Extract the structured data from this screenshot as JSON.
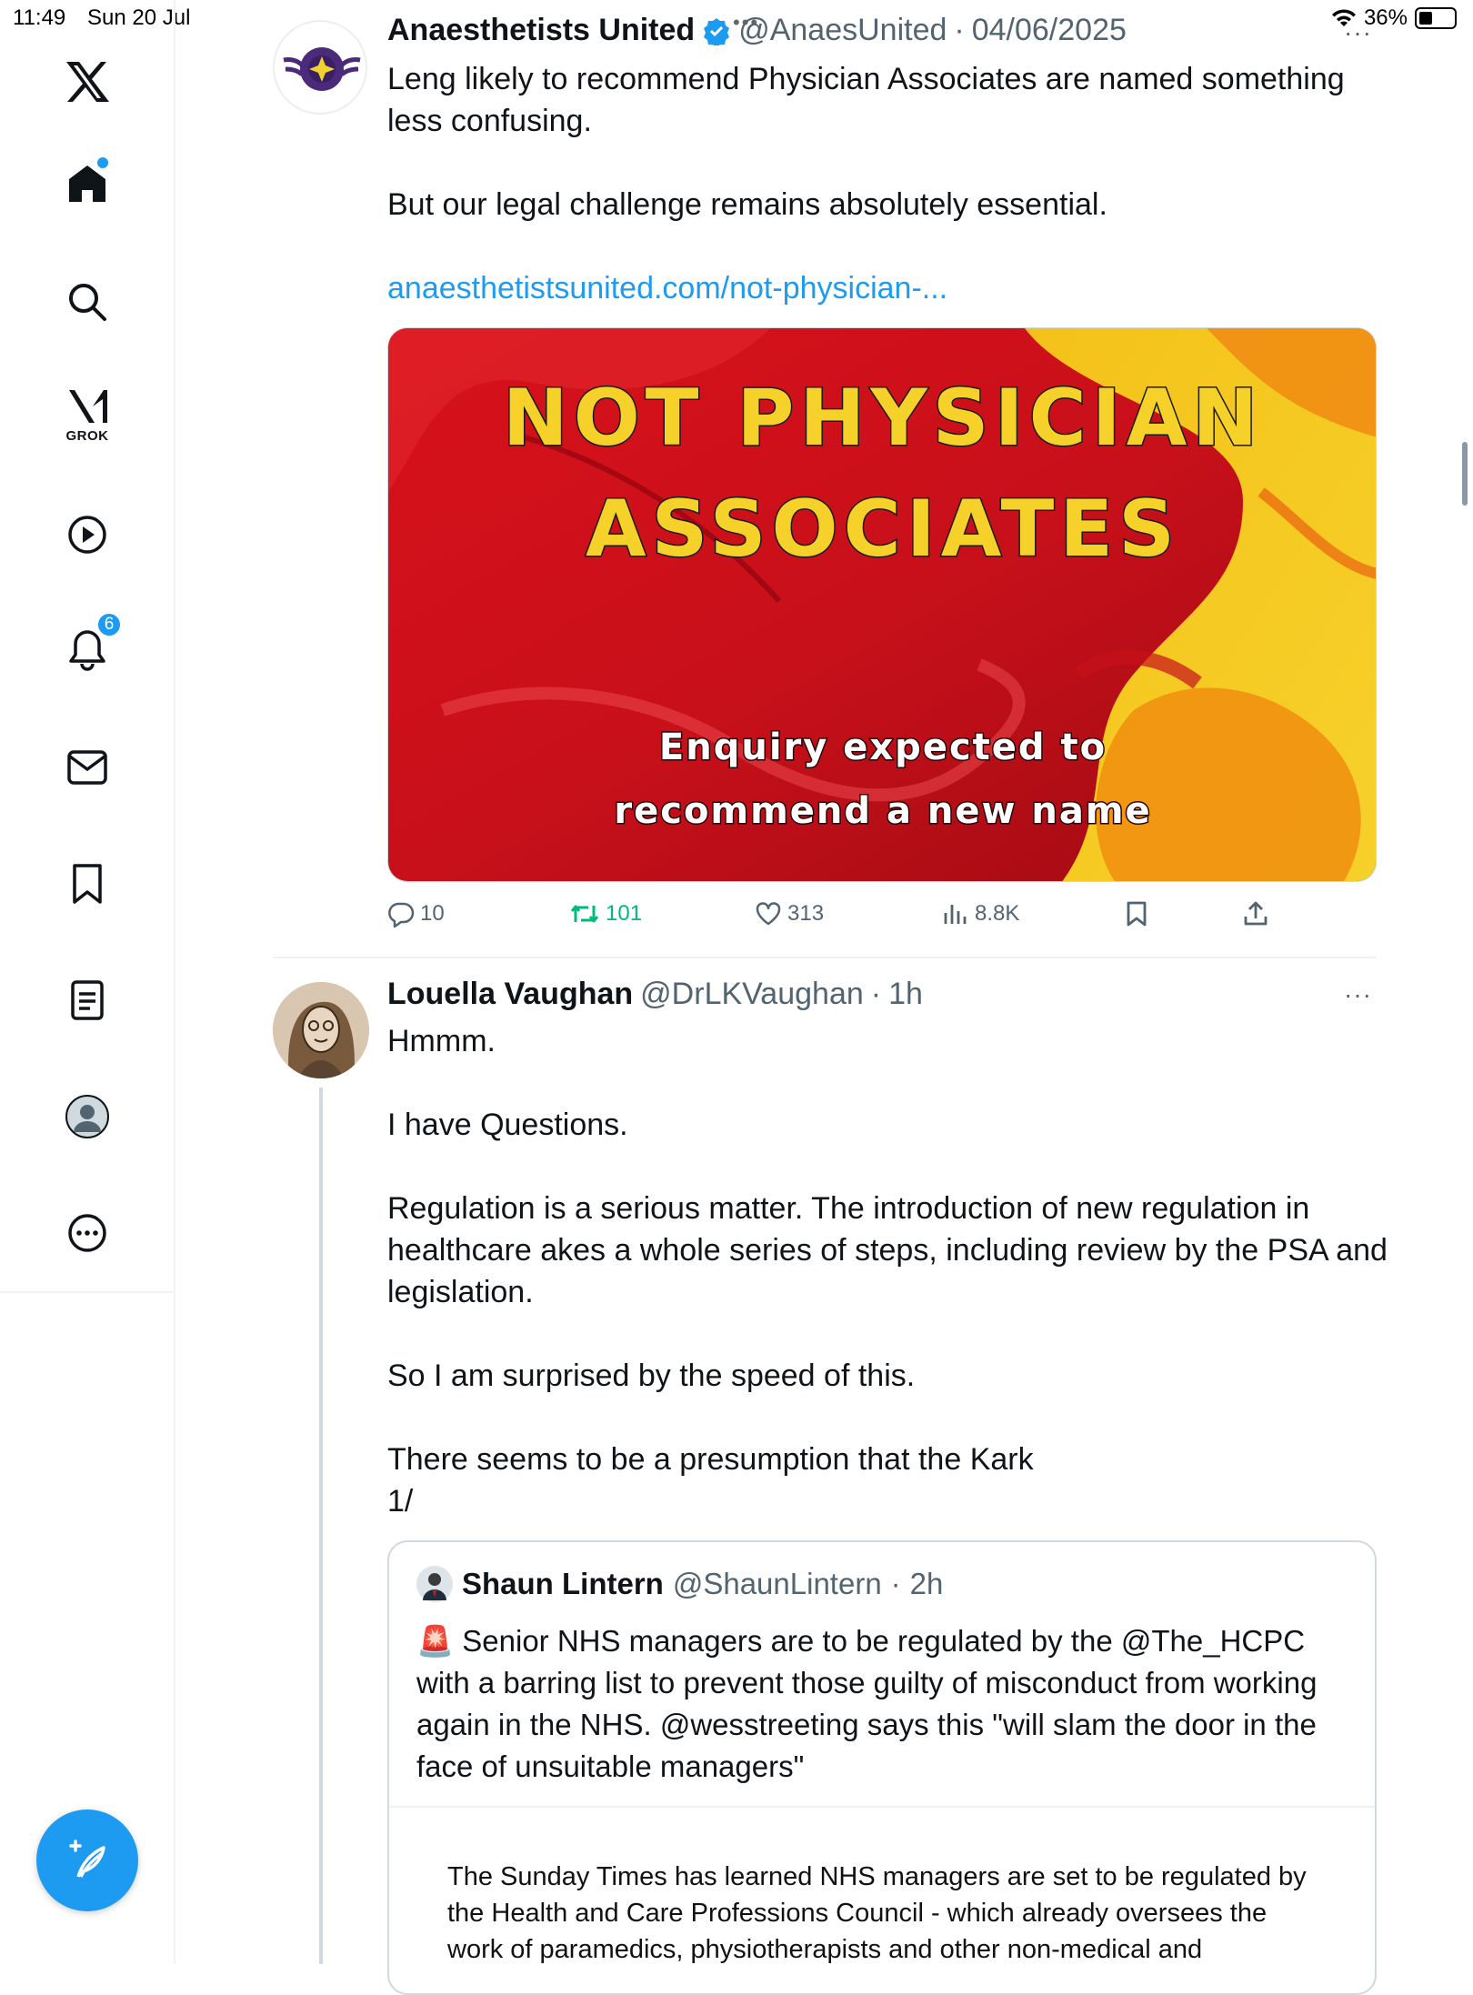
{
  "status_bar": {
    "time": "11:49",
    "date": "Sun 20 Jul",
    "battery": "36%"
  },
  "sidebar": {
    "items": [
      {
        "name": "x-logo"
      },
      {
        "name": "home"
      },
      {
        "name": "search"
      },
      {
        "name": "grok",
        "label": "GROK"
      },
      {
        "name": "video"
      },
      {
        "name": "notifications",
        "badge": "6"
      },
      {
        "name": "messages"
      },
      {
        "name": "bookmarks"
      },
      {
        "name": "lists"
      },
      {
        "name": "profile"
      },
      {
        "name": "more"
      }
    ]
  },
  "tweet1": {
    "name": "Anaesthetists United",
    "handle": "@AnaesUnited",
    "date": "04/06/2025",
    "lines": [
      "Leng likely to recommend Physician Associates are named something less confusing.",
      "But our legal challenge remains absolutely essential."
    ],
    "link": "anaesthetistsunited.com/not-physician-...",
    "media": {
      "title_line1": "NOT PHYSICIAN",
      "title_line2": "ASSOCIATES",
      "subtitle_line1": "Enquiry expected to",
      "subtitle_line2": "recommend a new name"
    },
    "metrics": {
      "replies": "10",
      "reposts": "101",
      "likes": "313",
      "views": "8.8K"
    }
  },
  "tweet2": {
    "name": "Louella Vaughan",
    "handle": "@DrLKVaughan",
    "time": "1h",
    "paragraphs": [
      "Hmmm.",
      "I have Questions.",
      "Regulation is a serious matter. The introduction of new regulation in healthcare akes a whole series of steps, including review by the PSA and legislation.",
      "So I am surprised by the speed of this.",
      "There seems to be a presumption that the Kark\n1/"
    ],
    "quote": {
      "name": "Shaun Lintern",
      "handle": "@ShaunLintern",
      "time": "2h",
      "emoji": "🚨",
      "text": "Senior NHS managers are to be regulated by the @The_HCPC with a barring list to prevent those guilty of misconduct from working again in the NHS. @wesstreeting says this \"will slam the door in the face of unsuitable managers\"",
      "article": "The Sunday Times has learned NHS managers are set to be regulated by the Health and Care Professions Council - which already oversees the work of paramedics, physiotherapists and other non-medical and"
    }
  },
  "colors": {
    "accent": "#1d9bf0",
    "repost": "#00ba7c",
    "muted": "#536471"
  }
}
